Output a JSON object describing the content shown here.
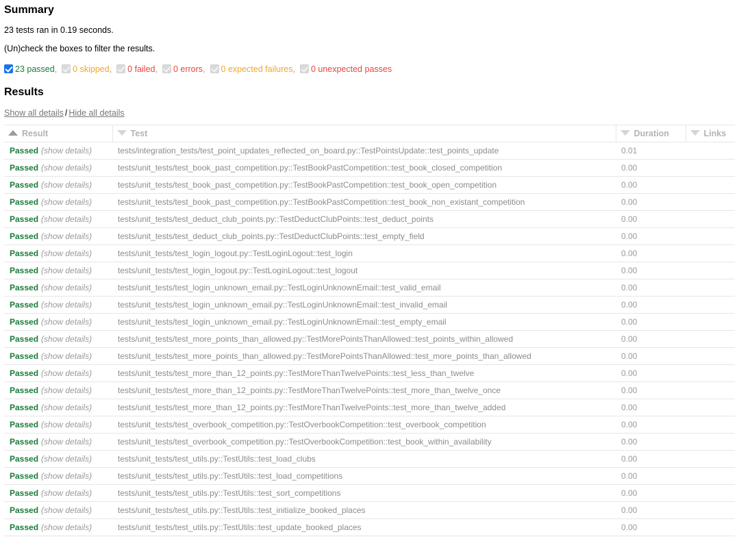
{
  "summary": {
    "title": "Summary",
    "ran_line": "23 tests ran in 0.19 seconds.",
    "filter_hint": "(Un)check the boxes to filter the results.",
    "filters": [
      {
        "name": "passed",
        "label": "23 passed",
        "checked": true,
        "enabled": true,
        "color": "#1a7a3c",
        "trailing": ","
      },
      {
        "name": "skipped",
        "label": "0 skipped",
        "checked": true,
        "enabled": false,
        "color": "#f5a623",
        "trailing": ","
      },
      {
        "name": "failed",
        "label": "0 failed",
        "checked": true,
        "enabled": false,
        "color": "#e8453c",
        "trailing": ","
      },
      {
        "name": "errors",
        "label": "0 errors",
        "checked": true,
        "enabled": false,
        "color": "#e8453c",
        "trailing": ","
      },
      {
        "name": "expected-failures",
        "label": "0 expected failures",
        "checked": true,
        "enabled": false,
        "color": "#f5a623",
        "trailing": ","
      },
      {
        "name": "unexpected-passes",
        "label": "0 unexpected passes",
        "checked": true,
        "enabled": false,
        "color": "#e8453c",
        "trailing": ""
      }
    ]
  },
  "results": {
    "title": "Results",
    "show_all_details": "Show all details",
    "separator": "/",
    "hide_all_details": "Hide all details",
    "columns": [
      {
        "key": "result",
        "label": "Result",
        "sort": "asc"
      },
      {
        "key": "test",
        "label": "Test",
        "sort": "desc"
      },
      {
        "key": "duration",
        "label": "Duration",
        "sort": "desc"
      },
      {
        "key": "links",
        "label": "Links",
        "sort": "desc"
      }
    ],
    "toggle_label": "(show details)",
    "rows": [
      {
        "result": "Passed",
        "test": "tests/integration_tests/test_point_updates_reflected_on_board.py::TestPointsUpdate::test_points_update",
        "duration": "0.01",
        "links": ""
      },
      {
        "result": "Passed",
        "test": "tests/unit_tests/test_book_past_competition.py::TestBookPastCompetition::test_book_closed_competition",
        "duration": "0.00",
        "links": ""
      },
      {
        "result": "Passed",
        "test": "tests/unit_tests/test_book_past_competition.py::TestBookPastCompetition::test_book_open_competition",
        "duration": "0.00",
        "links": ""
      },
      {
        "result": "Passed",
        "test": "tests/unit_tests/test_book_past_competition.py::TestBookPastCompetition::test_book_non_existant_competition",
        "duration": "0.00",
        "links": ""
      },
      {
        "result": "Passed",
        "test": "tests/unit_tests/test_deduct_club_points.py::TestDeductClubPoints::test_deduct_points",
        "duration": "0.00",
        "links": ""
      },
      {
        "result": "Passed",
        "test": "tests/unit_tests/test_deduct_club_points.py::TestDeductClubPoints::test_empty_field",
        "duration": "0.00",
        "links": ""
      },
      {
        "result": "Passed",
        "test": "tests/unit_tests/test_login_logout.py::TestLoginLogout::test_login",
        "duration": "0.00",
        "links": ""
      },
      {
        "result": "Passed",
        "test": "tests/unit_tests/test_login_logout.py::TestLoginLogout::test_logout",
        "duration": "0.00",
        "links": ""
      },
      {
        "result": "Passed",
        "test": "tests/unit_tests/test_login_unknown_email.py::TestLoginUnknownEmail::test_valid_email",
        "duration": "0.00",
        "links": ""
      },
      {
        "result": "Passed",
        "test": "tests/unit_tests/test_login_unknown_email.py::TestLoginUnknownEmail::test_invalid_email",
        "duration": "0.00",
        "links": ""
      },
      {
        "result": "Passed",
        "test": "tests/unit_tests/test_login_unknown_email.py::TestLoginUnknownEmail::test_empty_email",
        "duration": "0.00",
        "links": ""
      },
      {
        "result": "Passed",
        "test": "tests/unit_tests/test_more_points_than_allowed.py::TestMorePointsThanAllowed::test_points_within_allowed",
        "duration": "0.00",
        "links": ""
      },
      {
        "result": "Passed",
        "test": "tests/unit_tests/test_more_points_than_allowed.py::TestMorePointsThanAllowed::test_more_points_than_allowed",
        "duration": "0.00",
        "links": ""
      },
      {
        "result": "Passed",
        "test": "tests/unit_tests/test_more_than_12_points.py::TestMoreThanTwelvePoints::test_less_than_twelve",
        "duration": "0.00",
        "links": ""
      },
      {
        "result": "Passed",
        "test": "tests/unit_tests/test_more_than_12_points.py::TestMoreThanTwelvePoints::test_more_than_twelve_once",
        "duration": "0.00",
        "links": ""
      },
      {
        "result": "Passed",
        "test": "tests/unit_tests/test_more_than_12_points.py::TestMoreThanTwelvePoints::test_more_than_twelve_added",
        "duration": "0.00",
        "links": ""
      },
      {
        "result": "Passed",
        "test": "tests/unit_tests/test_overbook_competition.py::TestOverbookCompetition::test_overbook_competition",
        "duration": "0.00",
        "links": ""
      },
      {
        "result": "Passed",
        "test": "tests/unit_tests/test_overbook_competition.py::TestOverbookCompetition::test_book_within_availability",
        "duration": "0.00",
        "links": ""
      },
      {
        "result": "Passed",
        "test": "tests/unit_tests/test_utils.py::TestUtils::test_load_clubs",
        "duration": "0.00",
        "links": ""
      },
      {
        "result": "Passed",
        "test": "tests/unit_tests/test_utils.py::TestUtils::test_load_competitions",
        "duration": "0.00",
        "links": ""
      },
      {
        "result": "Passed",
        "test": "tests/unit_tests/test_utils.py::TestUtils::test_sort_competitions",
        "duration": "0.00",
        "links": ""
      },
      {
        "result": "Passed",
        "test": "tests/unit_tests/test_utils.py::TestUtils::test_initialize_booked_places",
        "duration": "0.00",
        "links": ""
      },
      {
        "result": "Passed",
        "test": "tests/unit_tests/test_utils.py::TestUtils::test_update_booked_places",
        "duration": "0.00",
        "links": ""
      }
    ]
  }
}
